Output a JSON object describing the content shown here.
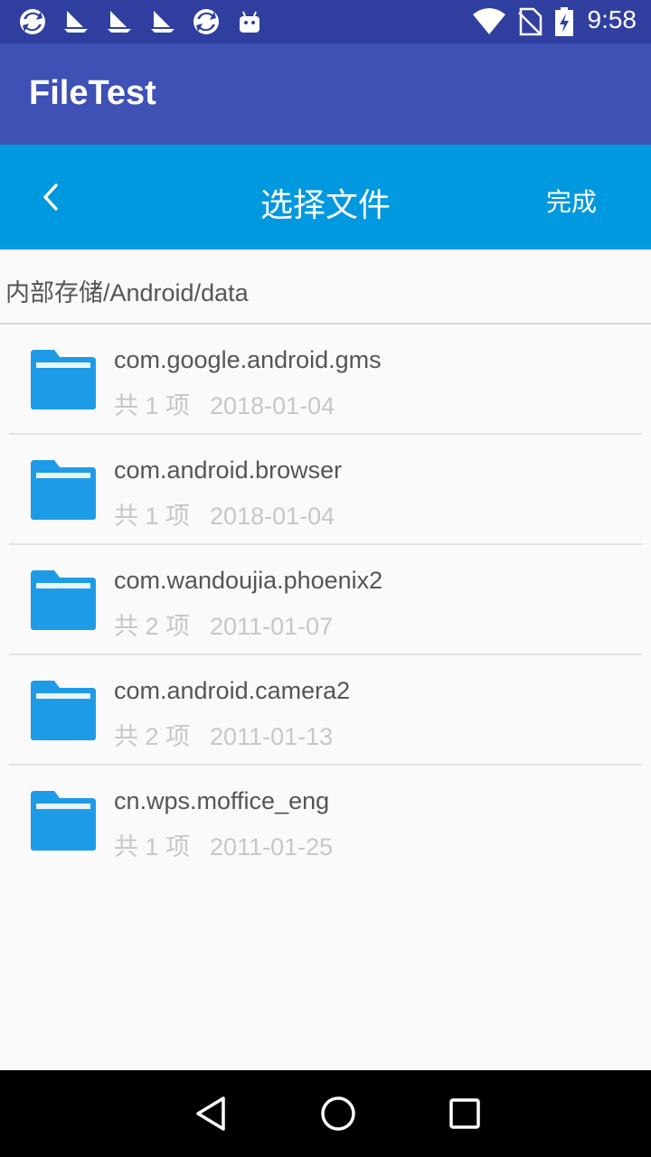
{
  "status_bar": {
    "time": "9:58",
    "icons": [
      "sync-icon",
      "boat-icon",
      "boat-icon",
      "boat-icon",
      "sync-icon",
      "android-icon"
    ],
    "right_icons": [
      "wifi-icon",
      "no-sim-icon",
      "battery-charging-icon"
    ]
  },
  "app_bar": {
    "title": "FileTest"
  },
  "picker": {
    "back_icon": "chevron-left-icon",
    "title": "选择文件",
    "done_label": "完成"
  },
  "path": "内部存储/Android/data",
  "files": [
    {
      "name": "com.google.android.gms",
      "count": "共 1 项",
      "date": "2018-01-04"
    },
    {
      "name": "com.android.browser",
      "count": "共 1 项",
      "date": "2018-01-04"
    },
    {
      "name": "com.wandoujia.phoenix2",
      "count": "共 2 项",
      "date": "2011-01-07"
    },
    {
      "name": "com.android.camera2",
      "count": "共 2 项",
      "date": "2011-01-13"
    },
    {
      "name": "cn.wps.moffice_eng",
      "count": "共 1 项",
      "date": "2011-01-25"
    }
  ],
  "colors": {
    "status_bar": "#303f9f",
    "app_bar": "#3f51b5",
    "picker_bar": "#0098df",
    "folder": "#1e9be6"
  },
  "nav": {
    "icons": [
      "back-triangle-icon",
      "home-circle-icon",
      "recents-square-icon"
    ]
  }
}
